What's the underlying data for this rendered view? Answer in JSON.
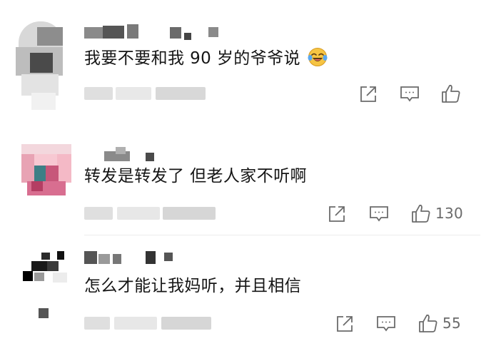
{
  "comments": [
    {
      "text": "我要不要和我 90 岁的爷爷说",
      "emoji": "laughing-crying-face-icon",
      "like_count": ""
    },
    {
      "text": "转发是转发了 但老人家不听啊",
      "emoji": "",
      "like_count": "130"
    },
    {
      "text": "怎么才能让我妈听，并且相信",
      "emoji": "",
      "like_count": "55"
    }
  ],
  "colors": {
    "text": "#151515",
    "icon": "#6b6b6b",
    "emoji_face": "#f6c443",
    "emoji_tear": "#5aa8f0"
  }
}
